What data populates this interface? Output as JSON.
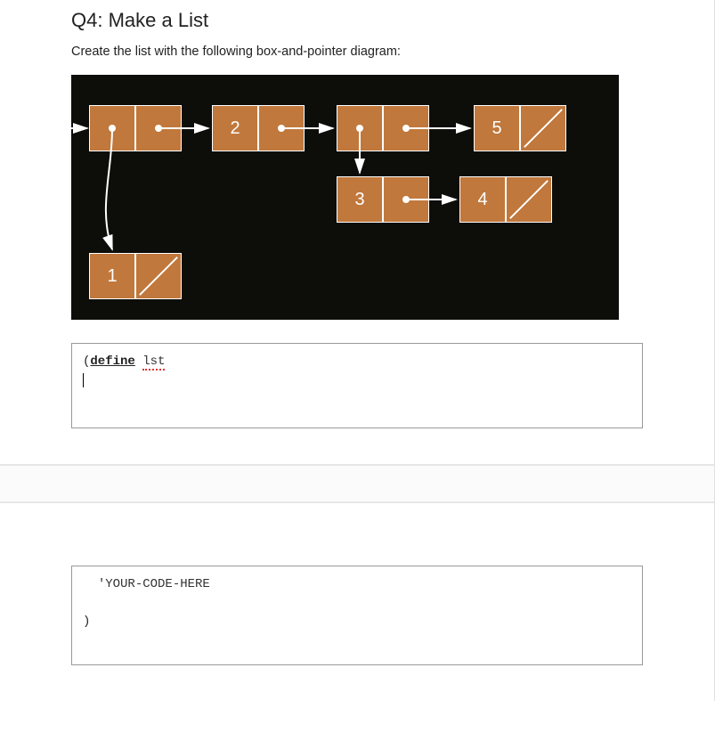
{
  "title": "Q4: Make a List",
  "instruction": "Create the list with the following box-and-pointer diagram:",
  "diagram": {
    "values": {
      "v1": "1",
      "v2": "2",
      "v3": "3",
      "v4": "4",
      "v5": "5"
    }
  },
  "code_top": {
    "open_paren": "(",
    "define_kw": "define",
    "var": "lst"
  },
  "code_bottom": {
    "placeholder": "'YOUR-CODE-HERE",
    "close_paren": ")"
  }
}
